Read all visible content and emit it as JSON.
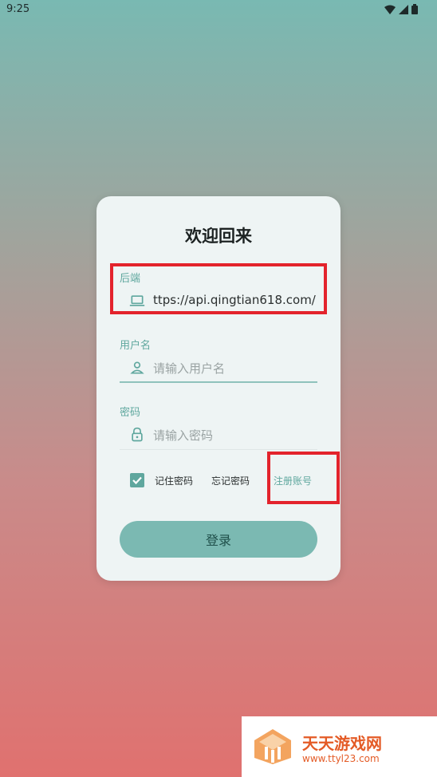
{
  "status_bar": {
    "time": "9:25"
  },
  "login": {
    "title": "欢迎回来",
    "backend": {
      "label": "后端",
      "value": "ttps://api.qingtian618.com/"
    },
    "username": {
      "label": "用户名",
      "placeholder": "请输入用户名"
    },
    "password": {
      "label": "密码",
      "placeholder": "请输入密码"
    },
    "remember_label": "记住密码",
    "remember_checked": true,
    "forgot_label": "忘记密码",
    "register_label": "注册账号",
    "login_button": "登录"
  },
  "watermark": {
    "title": "天天游戏网",
    "url": "www.ttyl23.com"
  },
  "colors": {
    "accent": "#5fa79e",
    "button": "#7bb9b2",
    "highlight": "#e3232c",
    "gradient_top": "#79b9b2",
    "gradient_bottom": "#e0716f"
  }
}
